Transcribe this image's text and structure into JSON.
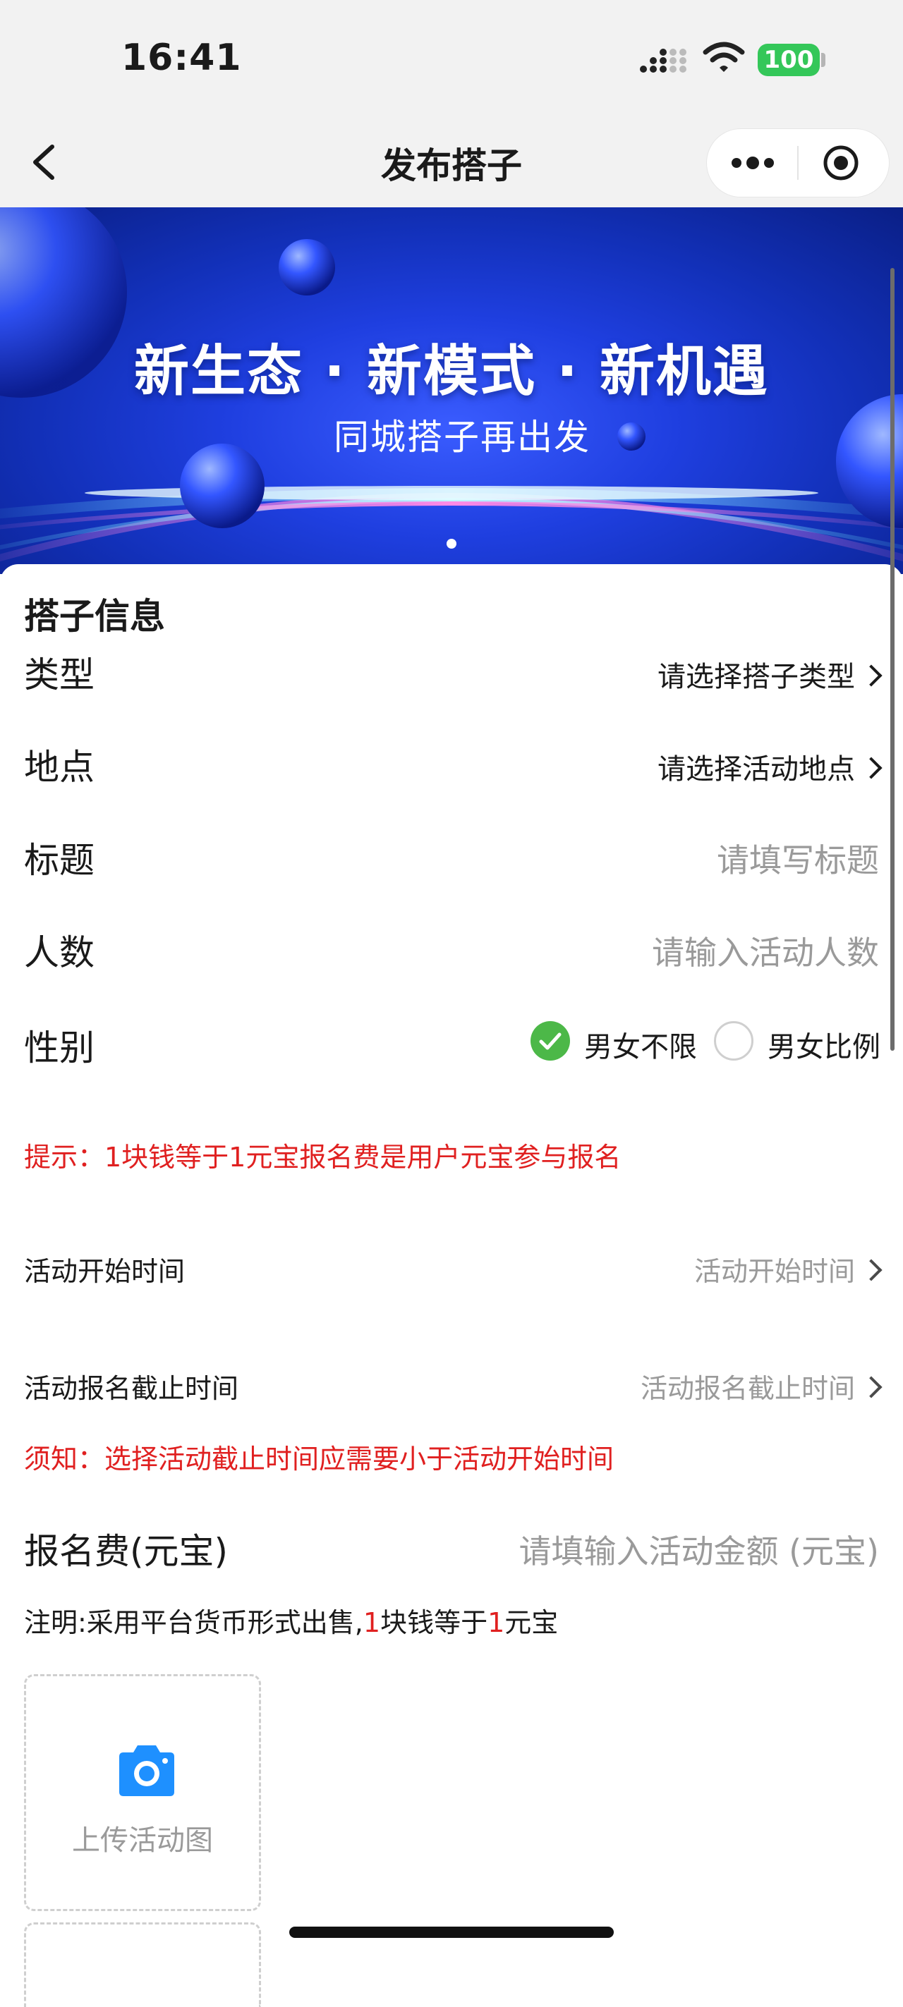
{
  "status_bar": {
    "time": "16:41",
    "battery": "100"
  },
  "nav": {
    "title": "发布搭子"
  },
  "banner": {
    "headline": "新生态 · 新模式 · 新机遇",
    "subline": "同城搭子再出发"
  },
  "form": {
    "section_title": "搭子信息",
    "type": {
      "label": "类型",
      "value": "请选择搭子类型"
    },
    "location": {
      "label": "地点",
      "value": "请选择活动地点"
    },
    "title": {
      "label": "标题",
      "placeholder": "请填写标题"
    },
    "people": {
      "label": "人数",
      "placeholder": "请输入活动人数"
    },
    "gender": {
      "label": "性别",
      "options": [
        {
          "label": "男女不限",
          "selected": true
        },
        {
          "label": "男女比例",
          "selected": false
        }
      ]
    },
    "hint": "提示：1块钱等于1元宝报名费是用户元宝参与报名",
    "start_time": {
      "label": "活动开始时间",
      "value": "活动开始时间"
    },
    "deadline": {
      "label": "活动报名截止时间",
      "value": "活动报名截止时间"
    },
    "notice": "须知：选择活动截止时间应需要小于活动开始时间",
    "fee": {
      "label": "报名费(元宝)",
      "placeholder": "请填输入活动金额 (元宝)"
    },
    "note_parts": [
      "注明:采用平台货币形式出售,",
      "1",
      "块钱等于",
      "1",
      "元宝"
    ],
    "upload": {
      "label": "上传活动图"
    }
  },
  "colors": {
    "accent_green": "#4cb848",
    "warning_red": "#e02020",
    "upload_blue": "#1e90ff"
  }
}
